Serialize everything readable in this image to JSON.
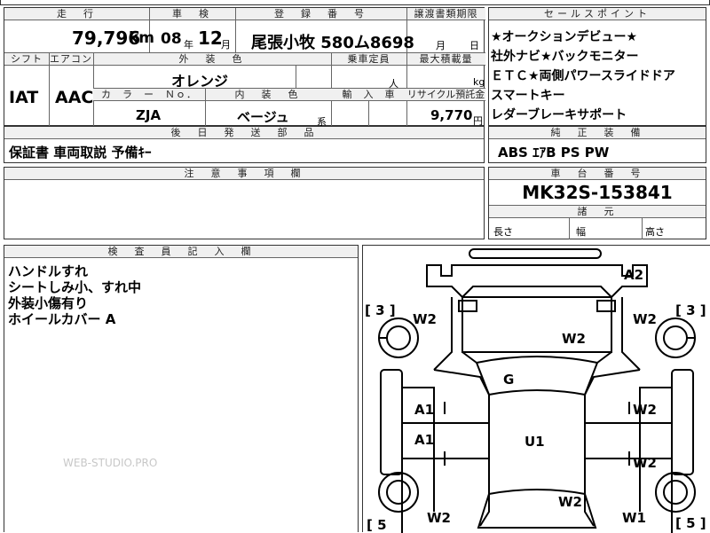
{
  "headers": {
    "mileage": "走　行",
    "inspection": "車　検",
    "registration": "登　録　番　号",
    "transfer_deadline": "譲渡書類期限",
    "sales_points": "セールスポイント",
    "shift": "シフト",
    "aircon": "エアコン",
    "exterior_color": "外　装　色",
    "capacity": "乗車定員",
    "max_load": "最大積載量",
    "color_no": "カ　ラ　ー　Ｎｏ．",
    "interior_color": "内　装　色",
    "import": "輸　入　車",
    "recycle_fee": "リサイクル預託金",
    "later_parts": "後　日　発　送　部　品",
    "genuine_equipment": "純　正　装　備",
    "notes": "注　意　事　項　欄",
    "chassis_no": "車　台　番　号",
    "dimensions": "諸　元",
    "inspector_notes": "検　査　員　記　入　欄"
  },
  "vehicle": {
    "mileage_value": "79,796",
    "mileage_unit": "km",
    "inspection_year": "08",
    "inspection_year_unit": "年",
    "inspection_month": "12",
    "inspection_month_unit": "月",
    "registration": "尾張小牧 580ム8698",
    "transfer_month_unit": "月",
    "transfer_day_unit": "日",
    "shift": "IAT",
    "aircon": "AAC",
    "exterior_color": "オレンジ",
    "capacity_unit": "人",
    "max_load_unit": "kg",
    "color_no": "ZJA",
    "interior_color": "ベージュ",
    "interior_suffix": "系",
    "recycle_fee": "9,770",
    "recycle_unit": "円",
    "chassis_no": "MK32S-153841",
    "length_label": "長さ",
    "width_label": "幅",
    "height_label": "高さ"
  },
  "sales_points": [
    "★オークションデビュー★",
    "社外ナビ★バックモニター",
    "ＥＴＣ★両側パワースライドドア",
    "スマートキー",
    "レダーブレーキサポート"
  ],
  "later_parts": "保証書 車両取説 予備ｷｰ",
  "genuine_equipment": "ABS ｴｱB PS PW",
  "inspector_notes": [
    "ハンドルすれ",
    "シートしみ小、すれ中",
    "外装小傷有り",
    "ホイールカバー A"
  ],
  "watermark": "WEB-STUDIO.PRO",
  "diagram": {
    "tire_front_left": "[ 3 ]",
    "tire_front_right": "[ 3 ]",
    "tire_rear_left": "[ 5",
    "tire_rear_right": "[ 5 ]",
    "a2": "A2",
    "w2_front_left": "W2",
    "w2_front_right": "W2",
    "w2_hood": "W2",
    "g_windshield": "G",
    "a1_left_1": "A1",
    "a1_left_2": "A1",
    "w2_right_1": "W2",
    "w2_right_2": "W2",
    "u1_roof": "U1",
    "w2_rear_center": "W2",
    "w2_rear_left": "W2",
    "w1_rear_right": "W1"
  }
}
